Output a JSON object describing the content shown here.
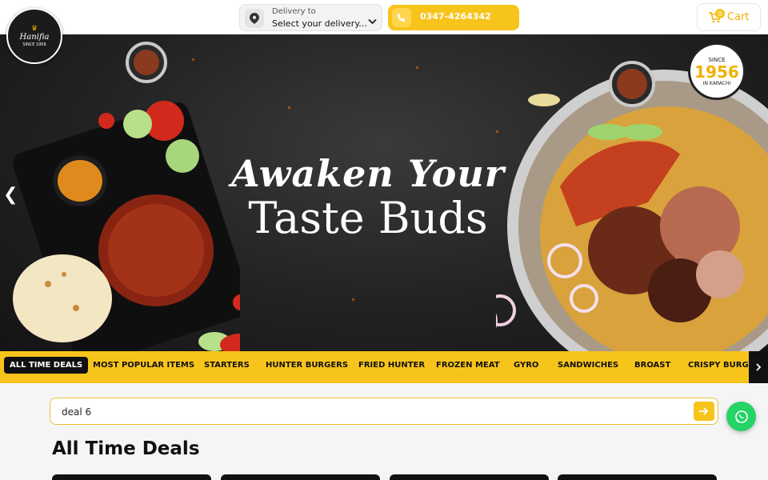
{
  "header": {
    "logo": {
      "brand": "Hanifia",
      "since": "SINCE 1956"
    },
    "delivery": {
      "label": "Delivery to",
      "value": "Select your delivery..."
    },
    "phone": "0347-4264342",
    "cart": {
      "count": "0",
      "label": "Cart"
    }
  },
  "hero": {
    "headline_line1": "Awaken Your",
    "headline_line2": "Taste Buds",
    "badge": {
      "top": "SINCE",
      "year": "1956",
      "bottom": "IN KARACHI"
    },
    "prev_arrow": "❮"
  },
  "categories": [
    "ALL TIME DEALS",
    "MOST POPULAR ITEMS",
    "STARTERS",
    "HUNTER BURGERS",
    "FRIED HUNTER",
    "FROZEN MEAT",
    "GYRO",
    "SANDWICHES",
    "BROAST",
    "CRISPY BURGER"
  ],
  "active_category": "ALL TIME DEALS",
  "search": {
    "value": "deal 6"
  },
  "section_title": "All Time Deals",
  "colors": {
    "accent": "#f7c41c",
    "whatsapp": "#25d366",
    "dark": "#111111"
  },
  "icons": [
    "map-pin-icon",
    "chevron-down-icon",
    "phone-icon",
    "cart-icon",
    "arrow-right-icon",
    "whatsapp-icon",
    "chevron-right-icon"
  ]
}
